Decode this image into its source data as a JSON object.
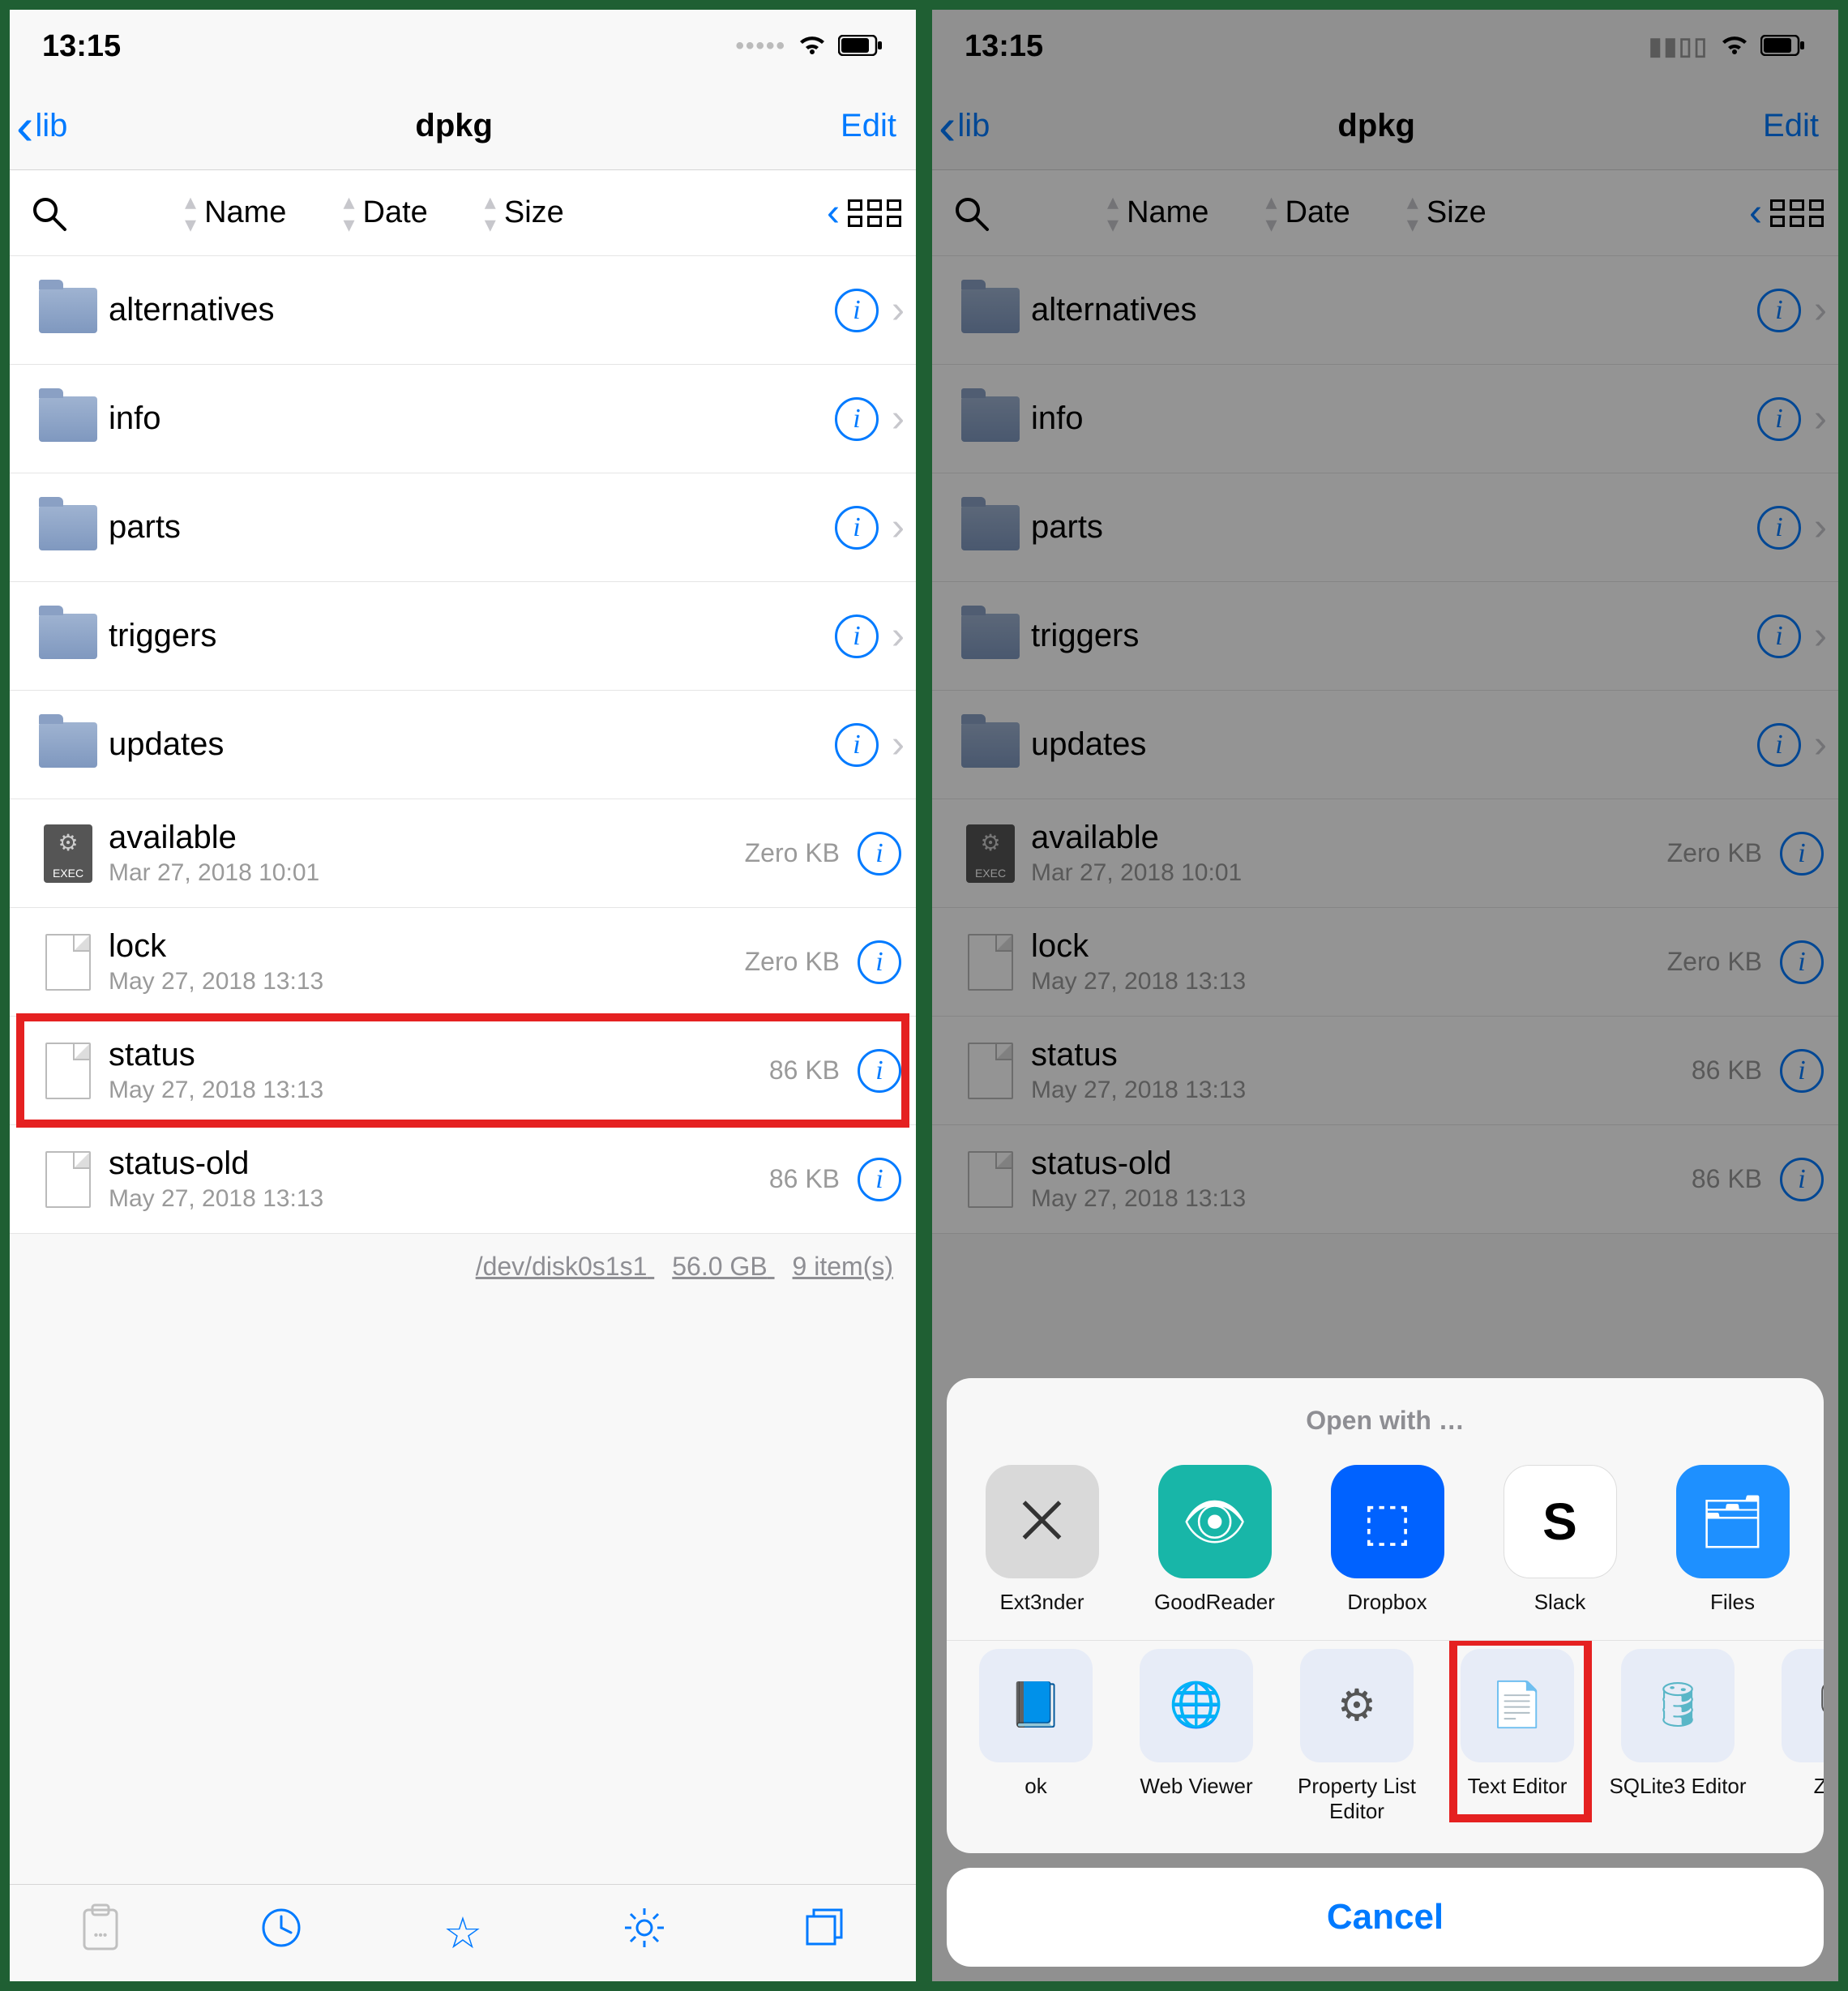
{
  "status": {
    "time": "13:15"
  },
  "nav": {
    "back_label": "lib",
    "title": "dpkg",
    "edit_label": "Edit"
  },
  "sort": {
    "name_label": "Name",
    "date_label": "Date",
    "size_label": "Size"
  },
  "rows": {
    "folders": [
      {
        "name": "alternatives"
      },
      {
        "name": "info"
      },
      {
        "name": "parts"
      },
      {
        "name": "triggers"
      },
      {
        "name": "updates"
      }
    ],
    "files": [
      {
        "name": "available",
        "date": "Mar 27, 2018 10:01",
        "size": "Zero KB",
        "kind": "exec"
      },
      {
        "name": "lock",
        "date": "May 27, 2018 13:13",
        "size": "Zero KB",
        "kind": "file"
      },
      {
        "name": "status",
        "date": "May 27, 2018 13:13",
        "size": "86 KB",
        "kind": "file",
        "highlighted": true
      },
      {
        "name": "status-old",
        "date": "May 27, 2018 13:13",
        "size": "86 KB",
        "kind": "file"
      }
    ]
  },
  "footer": {
    "device": "/dev/disk0s1s1",
    "capacity": "56.0 GB",
    "count": "9 item(s)"
  },
  "exec_tag": "EXEC",
  "sheet": {
    "title": "Open with …",
    "apps": [
      {
        "label": "Ext3nder",
        "glyph": "⨉",
        "cls": "ic-ext3nder"
      },
      {
        "label": "GoodReader",
        "glyph": "👁",
        "cls": "ic-goodreader"
      },
      {
        "label": "Dropbox",
        "glyph": "⬚",
        "cls": "ic-dropbox"
      },
      {
        "label": "Slack",
        "glyph": "S",
        "cls": "ic-slack"
      },
      {
        "label": "Files",
        "glyph": "🗂",
        "cls": "ic-files"
      }
    ],
    "actions": [
      {
        "label": "ok",
        "glyph": "📘"
      },
      {
        "label": "Web Viewer",
        "glyph": "🌐"
      },
      {
        "label": "Property List Editor",
        "glyph": "⚙"
      },
      {
        "label": "Text Editor",
        "glyph": "📄",
        "highlighted": true
      },
      {
        "label": "SQLite3 Editor",
        "glyph": "🛢",
        "cls": "ic-db"
      },
      {
        "label": "Zip V",
        "glyph": "🗜"
      }
    ],
    "cancel_label": "Cancel"
  }
}
